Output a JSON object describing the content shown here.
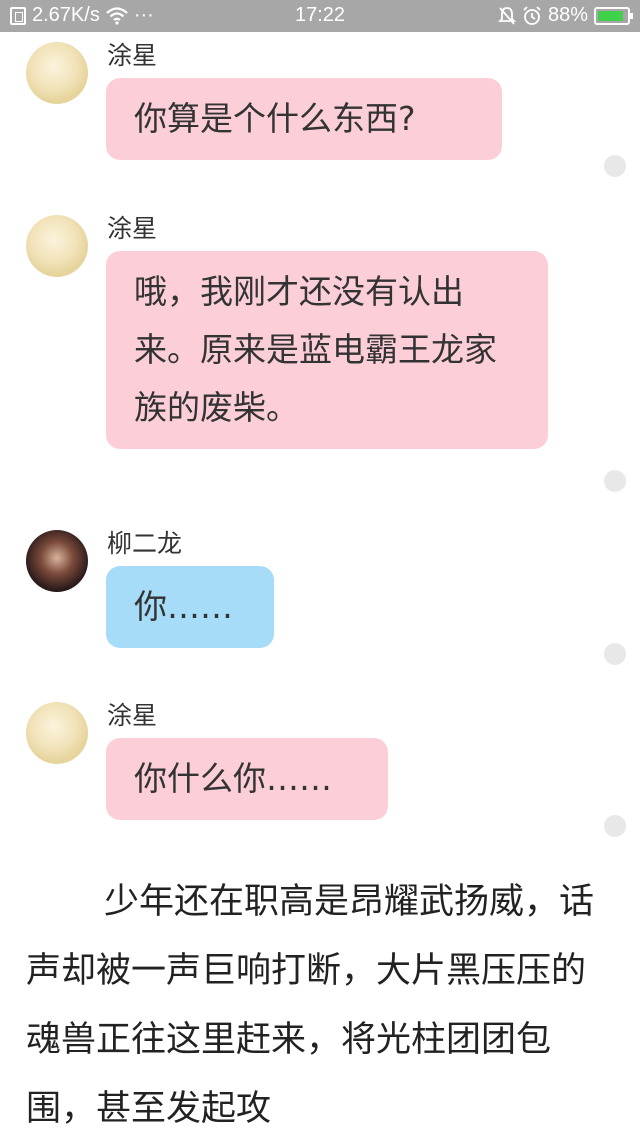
{
  "status_bar": {
    "net_speed": "2.67K/s",
    "wifi_icon": "wifi-icon",
    "more": "···",
    "time": "17:22",
    "battery": "88%",
    "battery_level": 0.88,
    "battery_color": "#3fd14b"
  },
  "messages": [
    {
      "sender": "涂星",
      "text": "你算是个什么东西?",
      "style": "pink"
    },
    {
      "sender": "涂星",
      "text": "哦，我刚才还没有认出来。原来是蓝电霸王龙家族的废柴。",
      "style": "pink"
    },
    {
      "sender": "柳二龙",
      "text": "你……",
      "style": "blue"
    },
    {
      "sender": "涂星",
      "text": "你什么你……",
      "style": "pink"
    }
  ],
  "narrative": "少年还在职高是昂耀武扬威，话声却被一声巨响打断，大片黑压压的魂兽正往这里赶来，将光柱团团包围，甚至发起攻",
  "colors": {
    "pink_bubble": "#fccfd8",
    "blue_bubble": "#a6dcf7",
    "status_bar": "#a7a7a7"
  }
}
